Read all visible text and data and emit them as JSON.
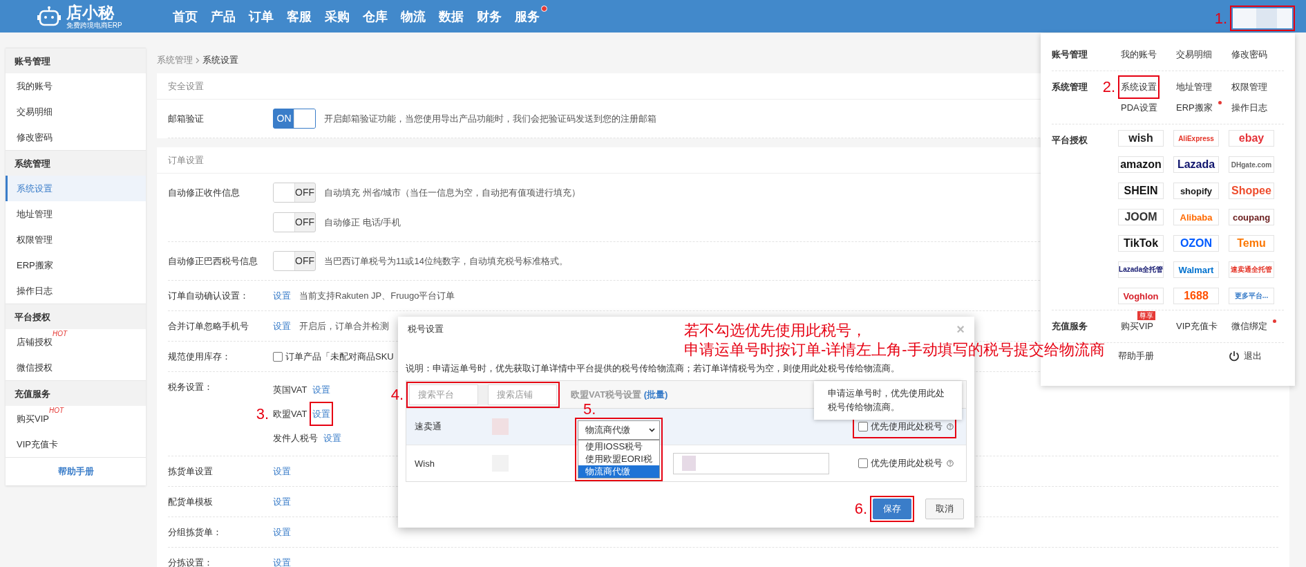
{
  "header": {
    "brand": "店小秘",
    "tagline": "免费跨境电商ERP",
    "nav": [
      {
        "label": "首页",
        "dot": false
      },
      {
        "label": "产品",
        "dot": false
      },
      {
        "label": "订单",
        "dot": false
      },
      {
        "label": "客服",
        "dot": false
      },
      {
        "label": "采购",
        "dot": false
      },
      {
        "label": "仓库",
        "dot": false
      },
      {
        "label": "物流",
        "dot": false
      },
      {
        "label": "数据",
        "dot": false
      },
      {
        "label": "财务",
        "dot": false
      },
      {
        "label": "服务",
        "dot": true
      }
    ],
    "account": {
      "highlighted": true,
      "step": "1."
    }
  },
  "sidebar": {
    "groups": [
      {
        "title": "账号管理",
        "items": [
          {
            "label": "我的账号",
            "selected": false
          },
          {
            "label": "交易明细",
            "selected": false
          },
          {
            "label": "修改密码",
            "selected": false
          }
        ]
      },
      {
        "title": "系统管理",
        "items": [
          {
            "label": "系统设置",
            "selected": true
          },
          {
            "label": "地址管理",
            "selected": false
          },
          {
            "label": "权限管理",
            "selected": false
          },
          {
            "label": "ERP搬家",
            "selected": false
          },
          {
            "label": "操作日志",
            "selected": false
          }
        ]
      },
      {
        "title": "平台授权",
        "items": [
          {
            "label": "店铺授权",
            "badge": "HOT",
            "selected": false
          },
          {
            "label": "微信授权",
            "selected": false
          }
        ]
      },
      {
        "title": "充值服务",
        "items": [
          {
            "label": "购买VIP",
            "badge": "HOT",
            "selected": false
          },
          {
            "label": "VIP充值卡",
            "selected": false
          }
        ]
      }
    ],
    "help": "帮助手册"
  },
  "breadcrumb": [
    "系统管理",
    "系统设置"
  ],
  "sections": [
    {
      "title": "安全设置",
      "rows": [
        {
          "label": "邮箱验证",
          "kind": "toggle",
          "toggles": [
            {
              "on": true,
              "text": "ON",
              "desc": "开启邮箱验证功能，当您使用导出产品功能时，我们会把验证码发送到您的注册邮箱"
            }
          ]
        }
      ]
    },
    {
      "title": "订单设置",
      "rows": [
        {
          "label": "自动修正收件信息",
          "kind": "toggle",
          "toggles": [
            {
              "on": false,
              "text": "OFF",
              "desc": "自动填充 州省/城市（当任一信息为空，自动把有值项进行填充）"
            },
            {
              "on": false,
              "text": "OFF",
              "desc": "自动修正 电话/手机"
            }
          ]
        },
        {
          "label": "自动修正巴西税号信息",
          "kind": "toggle",
          "toggles": [
            {
              "on": false,
              "text": "OFF",
              "desc": "当巴西订单税号为11或14位纯数字，自动填充税号标准格式。"
            }
          ]
        },
        {
          "label": "订单自动确认设置：",
          "kind": "link",
          "link": "设置",
          "desc": "当前支持Rakuten JP、Fruugo平台订单"
        },
        {
          "label": "合并订单忽略手机号",
          "kind": "link",
          "link": "设置",
          "desc": "开启后，订单合并检测"
        },
        {
          "label": "规范使用库存：",
          "kind": "checkbox",
          "checked": false,
          "text": "订单产品「未配对商品SKU"
        },
        {
          "label": "税务设置：",
          "kind": "links",
          "links": [
            {
              "text": "英国VAT",
              "link": "设置",
              "highlighted": false
            },
            {
              "text": "欧盟VAT",
              "link": "设置",
              "highlighted": true,
              "step": "3."
            },
            {
              "text": "发件人税号",
              "link": "设置",
              "highlighted": false
            }
          ]
        },
        {
          "label": "拣货单设置",
          "kind": "link",
          "link": "设置"
        },
        {
          "label": "配货单模板",
          "kind": "link",
          "link": "设置"
        },
        {
          "label": "分组拣货单：",
          "kind": "link",
          "link": "设置"
        },
        {
          "label": "分拣设置：",
          "kind": "link",
          "link": "设置"
        }
      ]
    }
  ],
  "menu": {
    "groups": [
      {
        "title": "账号管理",
        "kind": "links",
        "items": [
          {
            "label": "我的账号",
            "highlighted": false,
            "dot": false
          },
          {
            "label": "交易明细",
            "highlighted": false,
            "dot": false
          },
          {
            "label": "修改密码",
            "highlighted": false,
            "dot": false
          }
        ]
      },
      {
        "title": "系统管理",
        "kind": "links",
        "items": [
          {
            "label": "系统设置",
            "highlighted": true,
            "step": "2.",
            "dot": false
          },
          {
            "label": "地址管理",
            "highlighted": false,
            "dot": false
          },
          {
            "label": "权限管理",
            "highlighted": false,
            "dot": false
          },
          {
            "label": "PDA设置",
            "highlighted": false,
            "dot": false
          },
          {
            "label": "ERP搬家",
            "highlighted": false,
            "dot": true
          },
          {
            "label": "操作日志",
            "highlighted": false,
            "dot": false
          }
        ]
      },
      {
        "title": "平台授权",
        "kind": "logos",
        "items": [
          {
            "label": "wish",
            "color": "#222222"
          },
          {
            "label": "AliExpress",
            "color": "#e43225"
          },
          {
            "label": "ebay",
            "color": "#e53238"
          },
          {
            "label": "amazon",
            "color": "#111111"
          },
          {
            "label": "Lazada",
            "color": "#0f146d"
          },
          {
            "label": "DHgate.com",
            "color": "#666666"
          },
          {
            "label": "SHEIN",
            "color": "#111111"
          },
          {
            "label": "shopify",
            "color": "#1a1a1a"
          },
          {
            "label": "Shopee",
            "color": "#ee4d2d"
          },
          {
            "label": "JOOM",
            "color": "#333333"
          },
          {
            "label": "Alibaba",
            "color": "#ff6a00"
          },
          {
            "label": "coupang",
            "color": "#6b1e1e"
          },
          {
            "label": "TikTok",
            "color": "#111111"
          },
          {
            "label": "OZON",
            "color": "#005bff"
          },
          {
            "label": "Temu",
            "color": "#fb7701"
          },
          {
            "label": "Lazada全托管",
            "color": "#0f146d"
          },
          {
            "label": "Walmart",
            "color": "#0071ce"
          },
          {
            "label": "速卖通全托管",
            "color": "#e43225"
          },
          {
            "label": "Voghlon",
            "color": "#d6202a"
          },
          {
            "label": "1688",
            "color": "#ff5000"
          },
          {
            "label": "更多平台...",
            "color": "#3a7dc9"
          }
        ]
      },
      {
        "title": "充值服务",
        "kind": "links",
        "items": [
          {
            "label": "购买VIP",
            "badge": "尊享",
            "highlighted": false,
            "dot": false
          },
          {
            "label": "VIP充值卡",
            "highlighted": false,
            "dot": false
          },
          {
            "label": "微信绑定",
            "highlighted": false,
            "dot": true
          }
        ]
      }
    ],
    "help": "帮助手册",
    "logout": "退出"
  },
  "dialog": {
    "title": "税号设置",
    "close": "×",
    "annotation": [
      "若不勾选优先使用此税号，",
      "申请运单号时按订单-详情左上角-手动填写的税号提交给物流商"
    ],
    "note": "说明：申请运单号时，优先获取订单详情中平台提供的税号传给物流商；若订单详情税号为空，则使用此处税号传给物流商。",
    "search": {
      "highlighted": true,
      "step": "4.",
      "fields": [
        {
          "placeholder": "搜索平台"
        },
        {
          "placeholder": "搜索店铺"
        }
      ]
    },
    "heading": "欧盟VAT税号设置",
    "batch": "(批量)",
    "tooltip": "申请运单号时，优先使用此处税号传给物流商。",
    "rows": [
      {
        "platform": "速卖通",
        "selected": true,
        "kind": "select",
        "select": {
          "value": "物流商代缴",
          "highlighted": true,
          "step": "5.",
          "options": [
            {
              "label": "使用IOSS税号",
              "selected": false
            },
            {
              "label": "使用欧盟EORI税",
              "selected": false
            },
            {
              "label": "物流商代缴",
              "selected": true
            }
          ]
        },
        "priority": {
          "label": "优先使用此处税号",
          "checked": false,
          "highlighted": true
        }
      },
      {
        "platform": "Wish",
        "selected": false,
        "kind": "input",
        "priority": {
          "label": "优先使用此处税号",
          "checked": false,
          "highlighted": false
        }
      }
    ],
    "buttons": [
      {
        "label": "保存",
        "kind": "primary",
        "highlighted": true,
        "step": "6."
      },
      {
        "label": "取消",
        "kind": "default",
        "highlighted": false
      }
    ]
  }
}
